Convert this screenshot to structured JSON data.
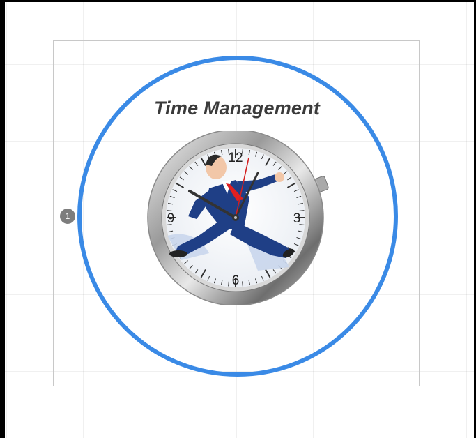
{
  "frame": {
    "title": "Time Management",
    "step_number": "1",
    "accent_color": "#3a8ae6",
    "illustration_icon": "running-businessman-clock-icon"
  },
  "clock": {
    "numerals": {
      "twelve": "12",
      "three": "3",
      "six": "6",
      "nine": "9"
    }
  }
}
